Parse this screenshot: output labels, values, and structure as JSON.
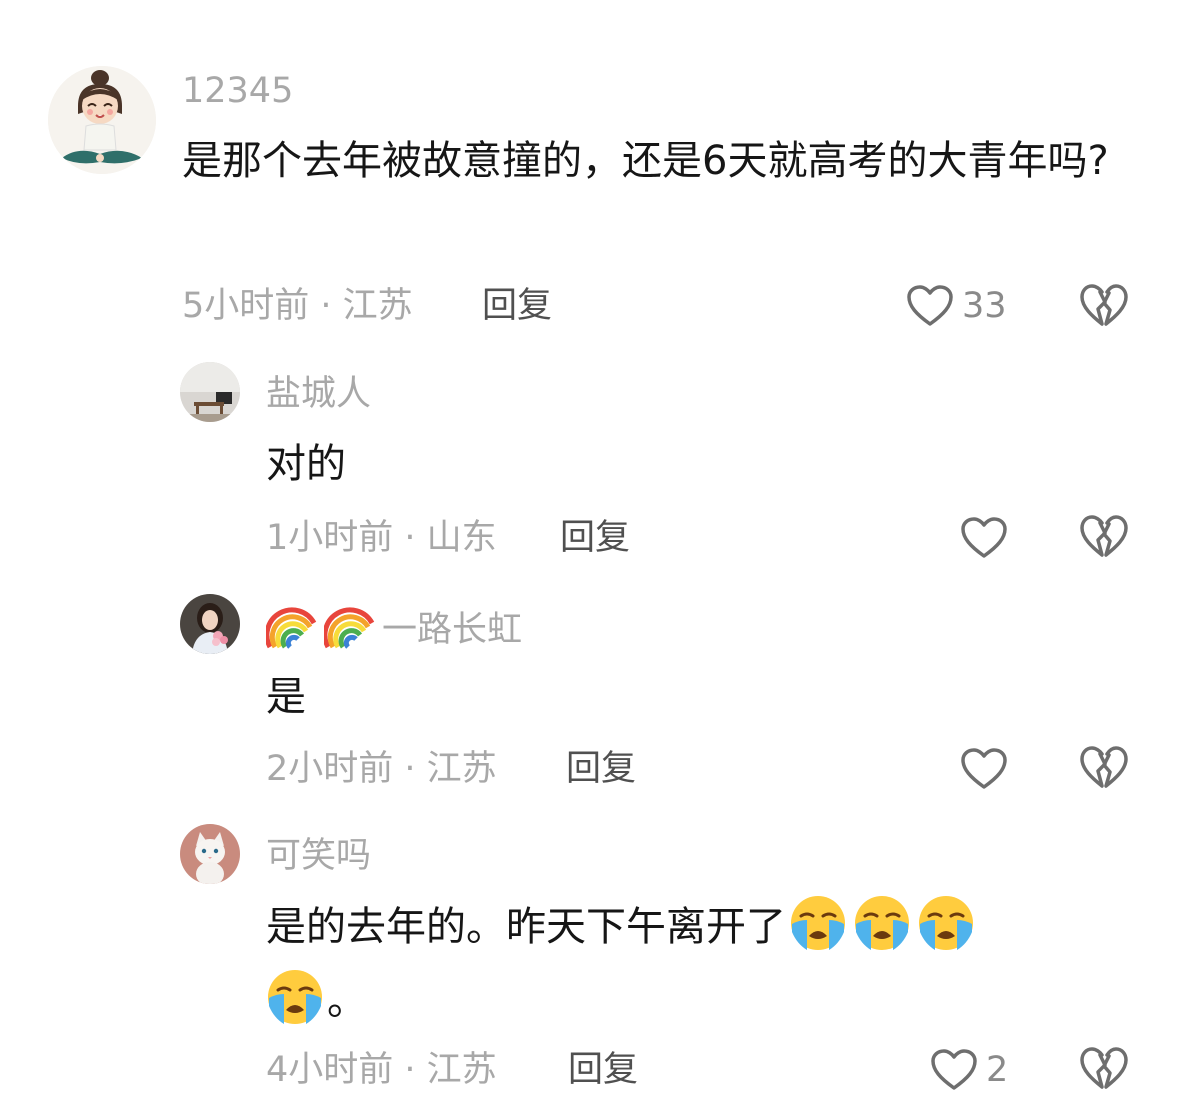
{
  "comments": [
    {
      "username": "12345",
      "content": "是那个去年被故意撞的，还是6天就高考的大青年吗?",
      "time_location": "5小时前 · 江苏",
      "reply_label": "回复",
      "like_count": "33",
      "avatar_icon": "cartoon-girl-avatar"
    },
    {
      "username": "盐城人",
      "content": "对的",
      "time_location": "1小时前 · 山东",
      "reply_label": "回复",
      "like_count": "",
      "avatar_icon": "room-photo-avatar"
    },
    {
      "username_prefix_icons": [
        "rainbow-emoji",
        "rainbow-emoji"
      ],
      "username": "一路长虹",
      "content": "是",
      "time_location": "2小时前 · 江苏",
      "reply_label": "回复",
      "like_count": "",
      "avatar_icon": "woman-with-flowers-avatar"
    },
    {
      "username": "可笑吗",
      "content": "是的去年的。昨天下午离开了",
      "content_trailing_emojis": [
        "loudly-crying-face",
        "loudly-crying-face",
        "loudly-crying-face",
        "loudly-crying-face"
      ],
      "content_end": "。",
      "time_location": "4小时前 · 江苏",
      "reply_label": "回复",
      "like_count": "2",
      "avatar_icon": "white-cat-avatar"
    }
  ],
  "colors": {
    "text_primary": "#161616",
    "text_secondary": "#a8a8a8",
    "reply_text": "#505050",
    "icon_stroke": "#6e6e6e"
  }
}
